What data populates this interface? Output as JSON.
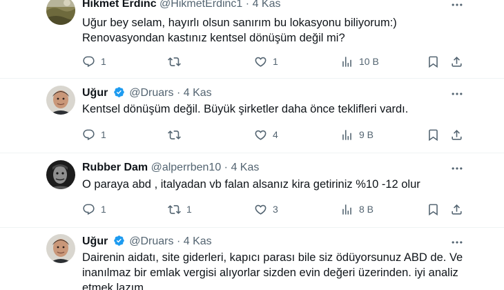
{
  "tweets": [
    {
      "name": "Hikmet Erdinc",
      "handle": "@HikmetErdinc1",
      "separator": "·",
      "time": "4 Kas",
      "verified": false,
      "text_lines": [
        "Uğur bey selam, hayırlı olsun sanırım bu lokasyonu biliyorum:)",
        "Renovasyondan kastınız kentsel dönüşüm değil mi?"
      ],
      "replies": "1",
      "retweets": "",
      "likes": "1",
      "views": "10 B",
      "avatar": "landscape-photo"
    },
    {
      "name": "Uğur",
      "handle": "@Druars",
      "separator": "·",
      "time": "4 Kas",
      "verified": true,
      "text_lines": [
        "Kentsel dönüşüm değil. Büyük şirketler daha önce teklifleri vardı."
      ],
      "replies": "1",
      "retweets": "",
      "likes": "4",
      "views": "9 B",
      "avatar": "man-portrait"
    },
    {
      "name": "Rubber Dam",
      "handle": "@alperrben10",
      "separator": "·",
      "time": "4 Kas",
      "verified": false,
      "text_lines": [
        "O paraya abd , italyadan vb falan alsanız kira getiriniz %10 -12 olur"
      ],
      "replies": "1",
      "retweets": "1",
      "likes": "3",
      "views": "8 B",
      "avatar": "bw-portrait"
    },
    {
      "name": "Uğur",
      "handle": "@Druars",
      "separator": "·",
      "time": "4 Kas",
      "verified": true,
      "text_lines": [
        "Dairenin aidatı, site giderleri, kapıcı parası bile siz ödüyorsunuz ABD de. Ve",
        "inanılmaz bir emlak vergisi alıyorlar sizden evin değeri üzerinden. iyi analiz",
        "etmek lazım."
      ],
      "avatar": "man-portrait"
    }
  ],
  "icons": {
    "reply": "reply-icon",
    "retweet": "retweet-icon",
    "like": "like-icon",
    "views": "views-icon",
    "bookmark": "bookmark-icon",
    "share": "share-icon",
    "more": "more-icon",
    "verified": "verified-badge-icon"
  },
  "colors": {
    "verified": "#1d9bf0",
    "text": "#0f1419",
    "secondary": "#536471",
    "divider": "#eff3f4"
  }
}
